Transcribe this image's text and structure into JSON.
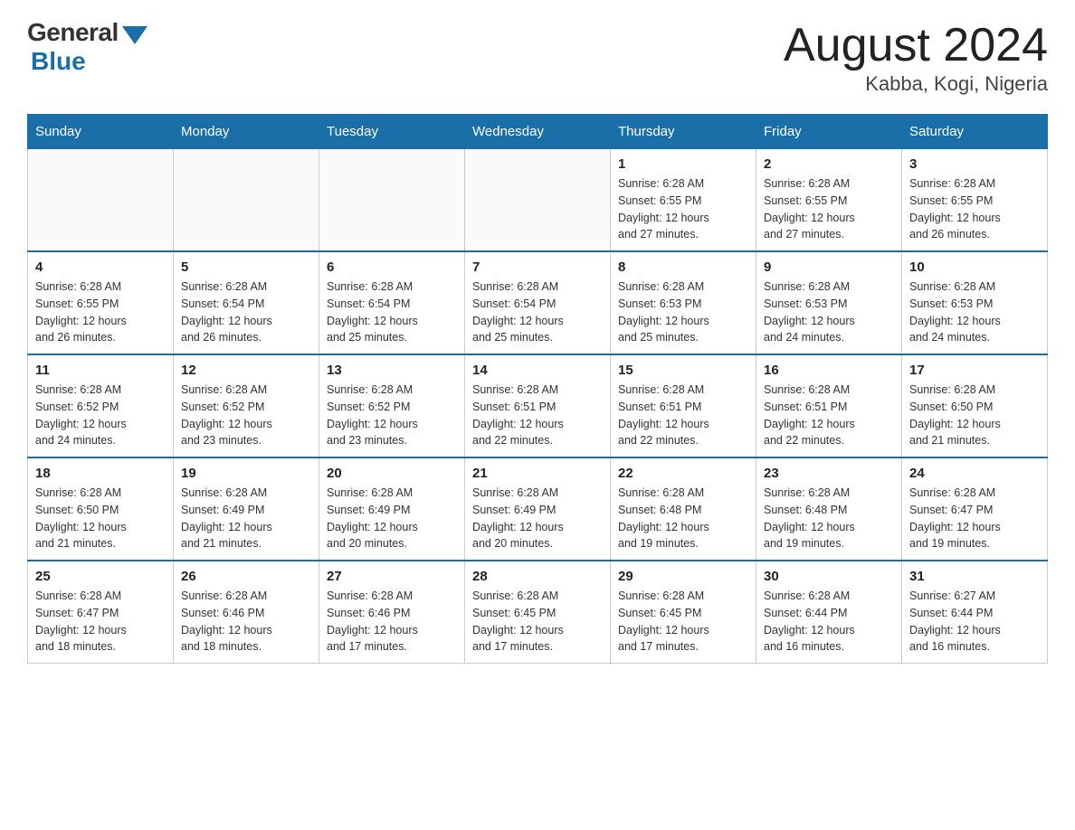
{
  "header": {
    "logo_general": "General",
    "logo_blue": "Blue",
    "title": "August 2024",
    "location": "Kabba, Kogi, Nigeria"
  },
  "weekdays": [
    "Sunday",
    "Monday",
    "Tuesday",
    "Wednesday",
    "Thursday",
    "Friday",
    "Saturday"
  ],
  "weeks": [
    [
      {
        "day": "",
        "info": ""
      },
      {
        "day": "",
        "info": ""
      },
      {
        "day": "",
        "info": ""
      },
      {
        "day": "",
        "info": ""
      },
      {
        "day": "1",
        "info": "Sunrise: 6:28 AM\nSunset: 6:55 PM\nDaylight: 12 hours\nand 27 minutes."
      },
      {
        "day": "2",
        "info": "Sunrise: 6:28 AM\nSunset: 6:55 PM\nDaylight: 12 hours\nand 27 minutes."
      },
      {
        "day": "3",
        "info": "Sunrise: 6:28 AM\nSunset: 6:55 PM\nDaylight: 12 hours\nand 26 minutes."
      }
    ],
    [
      {
        "day": "4",
        "info": "Sunrise: 6:28 AM\nSunset: 6:55 PM\nDaylight: 12 hours\nand 26 minutes."
      },
      {
        "day": "5",
        "info": "Sunrise: 6:28 AM\nSunset: 6:54 PM\nDaylight: 12 hours\nand 26 minutes."
      },
      {
        "day": "6",
        "info": "Sunrise: 6:28 AM\nSunset: 6:54 PM\nDaylight: 12 hours\nand 25 minutes."
      },
      {
        "day": "7",
        "info": "Sunrise: 6:28 AM\nSunset: 6:54 PM\nDaylight: 12 hours\nand 25 minutes."
      },
      {
        "day": "8",
        "info": "Sunrise: 6:28 AM\nSunset: 6:53 PM\nDaylight: 12 hours\nand 25 minutes."
      },
      {
        "day": "9",
        "info": "Sunrise: 6:28 AM\nSunset: 6:53 PM\nDaylight: 12 hours\nand 24 minutes."
      },
      {
        "day": "10",
        "info": "Sunrise: 6:28 AM\nSunset: 6:53 PM\nDaylight: 12 hours\nand 24 minutes."
      }
    ],
    [
      {
        "day": "11",
        "info": "Sunrise: 6:28 AM\nSunset: 6:52 PM\nDaylight: 12 hours\nand 24 minutes."
      },
      {
        "day": "12",
        "info": "Sunrise: 6:28 AM\nSunset: 6:52 PM\nDaylight: 12 hours\nand 23 minutes."
      },
      {
        "day": "13",
        "info": "Sunrise: 6:28 AM\nSunset: 6:52 PM\nDaylight: 12 hours\nand 23 minutes."
      },
      {
        "day": "14",
        "info": "Sunrise: 6:28 AM\nSunset: 6:51 PM\nDaylight: 12 hours\nand 22 minutes."
      },
      {
        "day": "15",
        "info": "Sunrise: 6:28 AM\nSunset: 6:51 PM\nDaylight: 12 hours\nand 22 minutes."
      },
      {
        "day": "16",
        "info": "Sunrise: 6:28 AM\nSunset: 6:51 PM\nDaylight: 12 hours\nand 22 minutes."
      },
      {
        "day": "17",
        "info": "Sunrise: 6:28 AM\nSunset: 6:50 PM\nDaylight: 12 hours\nand 21 minutes."
      }
    ],
    [
      {
        "day": "18",
        "info": "Sunrise: 6:28 AM\nSunset: 6:50 PM\nDaylight: 12 hours\nand 21 minutes."
      },
      {
        "day": "19",
        "info": "Sunrise: 6:28 AM\nSunset: 6:49 PM\nDaylight: 12 hours\nand 21 minutes."
      },
      {
        "day": "20",
        "info": "Sunrise: 6:28 AM\nSunset: 6:49 PM\nDaylight: 12 hours\nand 20 minutes."
      },
      {
        "day": "21",
        "info": "Sunrise: 6:28 AM\nSunset: 6:49 PM\nDaylight: 12 hours\nand 20 minutes."
      },
      {
        "day": "22",
        "info": "Sunrise: 6:28 AM\nSunset: 6:48 PM\nDaylight: 12 hours\nand 19 minutes."
      },
      {
        "day": "23",
        "info": "Sunrise: 6:28 AM\nSunset: 6:48 PM\nDaylight: 12 hours\nand 19 minutes."
      },
      {
        "day": "24",
        "info": "Sunrise: 6:28 AM\nSunset: 6:47 PM\nDaylight: 12 hours\nand 19 minutes."
      }
    ],
    [
      {
        "day": "25",
        "info": "Sunrise: 6:28 AM\nSunset: 6:47 PM\nDaylight: 12 hours\nand 18 minutes."
      },
      {
        "day": "26",
        "info": "Sunrise: 6:28 AM\nSunset: 6:46 PM\nDaylight: 12 hours\nand 18 minutes."
      },
      {
        "day": "27",
        "info": "Sunrise: 6:28 AM\nSunset: 6:46 PM\nDaylight: 12 hours\nand 17 minutes."
      },
      {
        "day": "28",
        "info": "Sunrise: 6:28 AM\nSunset: 6:45 PM\nDaylight: 12 hours\nand 17 minutes."
      },
      {
        "day": "29",
        "info": "Sunrise: 6:28 AM\nSunset: 6:45 PM\nDaylight: 12 hours\nand 17 minutes."
      },
      {
        "day": "30",
        "info": "Sunrise: 6:28 AM\nSunset: 6:44 PM\nDaylight: 12 hours\nand 16 minutes."
      },
      {
        "day": "31",
        "info": "Sunrise: 6:27 AM\nSunset: 6:44 PM\nDaylight: 12 hours\nand 16 minutes."
      }
    ]
  ]
}
